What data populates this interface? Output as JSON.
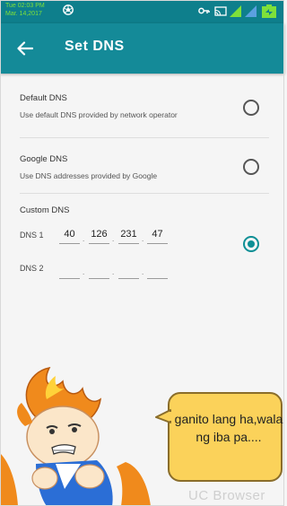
{
  "status_bar": {
    "time": "Tue 02:03 PM",
    "date": "Mar. 14,2017"
  },
  "app_bar": {
    "title": "Set DNS"
  },
  "options": {
    "default": {
      "title": "Default DNS",
      "description": "Use default DNS provided by network operator",
      "selected": false
    },
    "google": {
      "title": "Google DNS",
      "description": "Use DNS addresses provided by Google",
      "selected": false
    },
    "custom": {
      "title": "Custom DNS",
      "selected": true,
      "dns1_label": "DNS 1",
      "dns1": [
        "40",
        "126",
        "231",
        "47"
      ],
      "dns2_label": "DNS 2",
      "dns2": [
        "",
        "",
        "",
        ""
      ],
      "separator": "."
    }
  },
  "overlay": {
    "bubble_text": "ganito lang ha,wala ng iba pa....",
    "watermark": "UC Browser"
  },
  "colors": {
    "status_bar": "#0e7f8c",
    "app_bar": "#148a98",
    "accent": "#0e8f95",
    "bubble": "#fbd25a"
  }
}
